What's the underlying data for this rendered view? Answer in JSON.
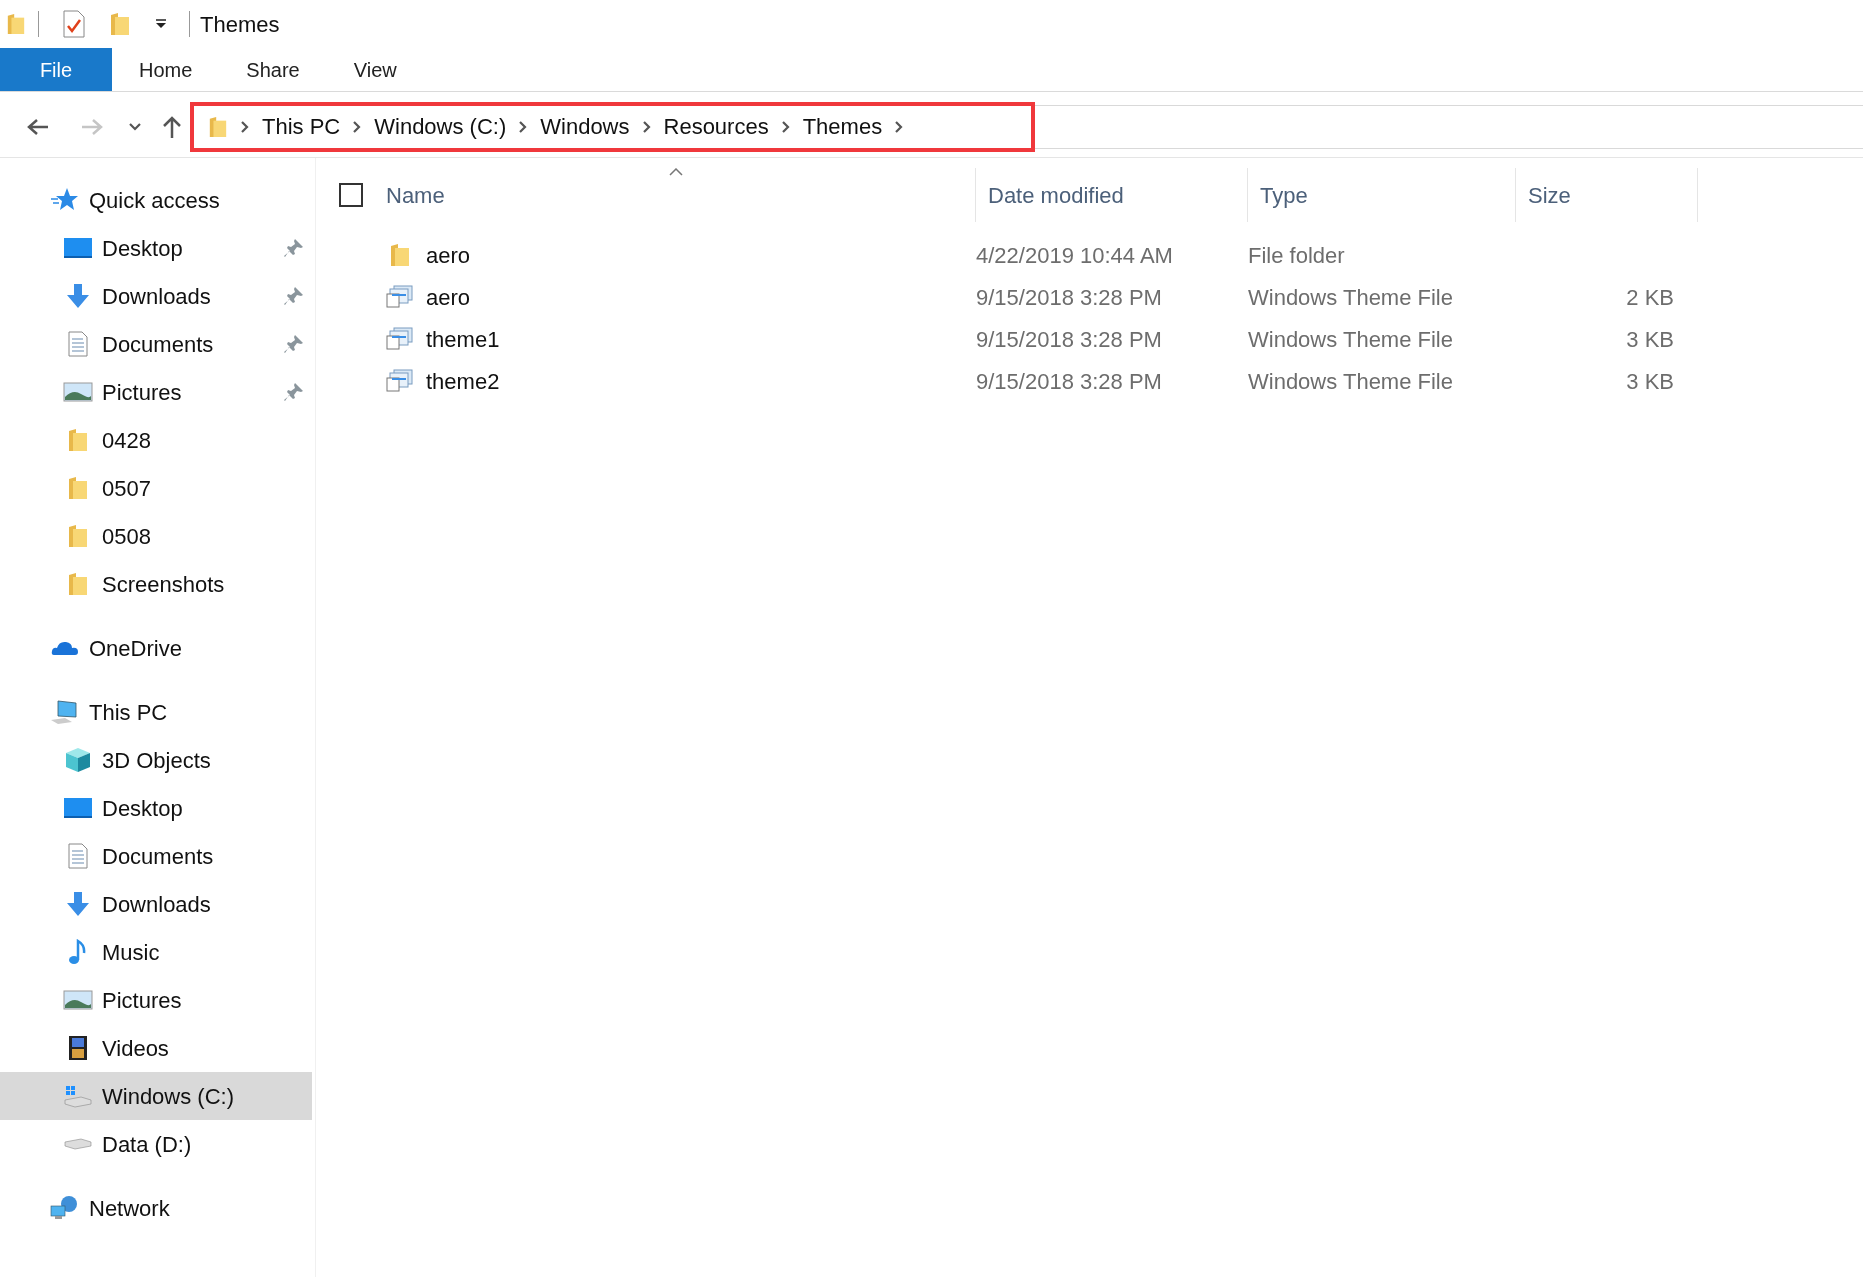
{
  "window": {
    "title": "Themes"
  },
  "ribbon_tabs": [
    {
      "label": "File",
      "kind": "file"
    },
    {
      "label": "Home",
      "kind": "tab"
    },
    {
      "label": "Share",
      "kind": "tab"
    },
    {
      "label": "View",
      "kind": "tab"
    }
  ],
  "navigation": {
    "back_disabled": false,
    "forward_disabled": true
  },
  "address_bar": {
    "highlighted": true,
    "crumbs": [
      "This PC",
      "Windows (C:)",
      "Windows",
      "Resources",
      "Themes"
    ]
  },
  "sidebar": {
    "items": [
      {
        "label": "Quick access",
        "kind": "star",
        "selected": false,
        "children": [
          {
            "label": "Desktop",
            "kind": "desktop",
            "pinned": true,
            "selected": false
          },
          {
            "label": "Downloads",
            "kind": "downloads",
            "pinned": true,
            "selected": false
          },
          {
            "label": "Documents",
            "kind": "documents",
            "pinned": true,
            "selected": false
          },
          {
            "label": "Pictures",
            "kind": "pictures",
            "pinned": true,
            "selected": false
          },
          {
            "label": "0428",
            "kind": "folder",
            "pinned": false,
            "selected": false
          },
          {
            "label": "0507",
            "kind": "folder",
            "pinned": false,
            "selected": false
          },
          {
            "label": "0508",
            "kind": "folder",
            "pinned": false,
            "selected": false
          },
          {
            "label": "Screenshots",
            "kind": "folder",
            "pinned": false,
            "selected": false
          }
        ]
      },
      {
        "label": "OneDrive",
        "kind": "cloud",
        "selected": false
      },
      {
        "label": "This PC",
        "kind": "computer",
        "selected": false,
        "children": [
          {
            "label": "3D Objects",
            "kind": "cube",
            "selected": false
          },
          {
            "label": "Desktop",
            "kind": "desktop",
            "selected": false
          },
          {
            "label": "Documents",
            "kind": "documents",
            "selected": false
          },
          {
            "label": "Downloads",
            "kind": "downloads",
            "selected": false
          },
          {
            "label": "Music",
            "kind": "music",
            "selected": false
          },
          {
            "label": "Pictures",
            "kind": "pictures",
            "selected": false
          },
          {
            "label": "Videos",
            "kind": "videos",
            "selected": false
          },
          {
            "label": "Windows (C:)",
            "kind": "system-drive",
            "selected": true
          },
          {
            "label": "Data (D:)",
            "kind": "drive",
            "selected": false
          }
        ]
      },
      {
        "label": "Network",
        "kind": "network",
        "selected": false
      }
    ]
  },
  "file_list": {
    "select_all_checked": false,
    "columns": [
      {
        "label": "Name",
        "sorted": true
      },
      {
        "label": "Date modified",
        "sorted": false
      },
      {
        "label": "Type",
        "sorted": false
      },
      {
        "label": "Size",
        "sorted": false
      }
    ],
    "rows": [
      {
        "name": "aero",
        "kind": "folder",
        "date": "4/22/2019 10:44 AM",
        "type": "File folder"
      },
      {
        "name": "aero",
        "kind": "theme",
        "date": "9/15/2018 3:28 PM",
        "type": "Windows Theme File",
        "size": "2 KB"
      },
      {
        "name": "theme1",
        "kind": "theme",
        "date": "9/15/2018 3:28 PM",
        "type": "Windows Theme File",
        "size": "3 KB"
      },
      {
        "name": "theme2",
        "kind": "theme",
        "date": "9/15/2018 3:28 PM",
        "type": "Windows Theme File",
        "size": "3 KB"
      }
    ]
  }
}
